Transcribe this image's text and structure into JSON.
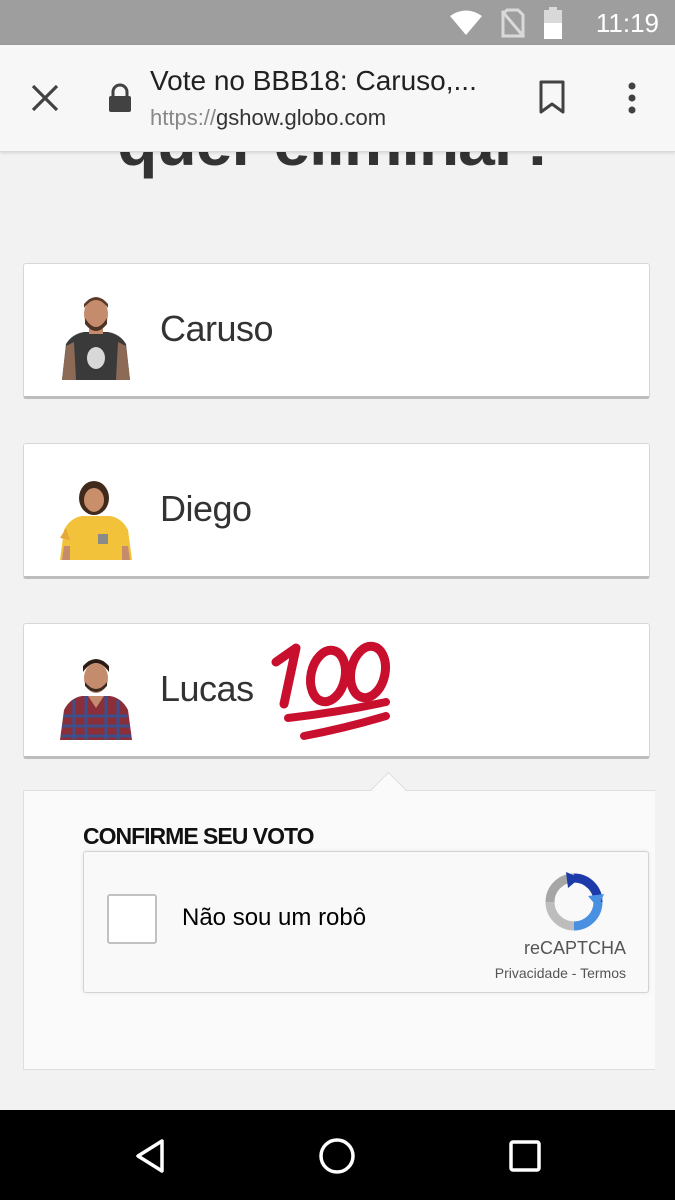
{
  "status_bar": {
    "time": "11:19",
    "icons": [
      "wifi-icon",
      "no-sim-icon",
      "battery-icon"
    ],
    "background": "#9e9e9e"
  },
  "browser": {
    "page_title": "Vote no BBB18: Caruso,...",
    "url_scheme": "https://",
    "url_host": "gshow.globo.com",
    "icons": [
      "close-icon",
      "lock-icon",
      "bookmark-icon",
      "more-vert-icon"
    ]
  },
  "content": {
    "heading": "quer eliminar?",
    "candidates": [
      {
        "name": "Caruso",
        "photo": "caruso-photo"
      },
      {
        "name": "Diego",
        "photo": "diego-photo"
      },
      {
        "name": "Lucas",
        "photo": "lucas-photo",
        "emoji": "hundred-points-emoji"
      }
    ],
    "confirm": {
      "title": "CONFIRME SEU VOTO",
      "recaptcha": {
        "label": "Não sou um robô",
        "brand": "reCAPTCHA",
        "privacy": "Privacidade",
        "separator": " - ",
        "terms": "Termos"
      }
    }
  },
  "nav_bar": {
    "icons": [
      "back-triangle-icon",
      "home-circle-icon",
      "recents-square-icon"
    ]
  },
  "colors": {
    "emoji_red": "#c8102e",
    "page_background": "#f2f2f2",
    "recaptcha_blue": "#1c3aa9"
  }
}
